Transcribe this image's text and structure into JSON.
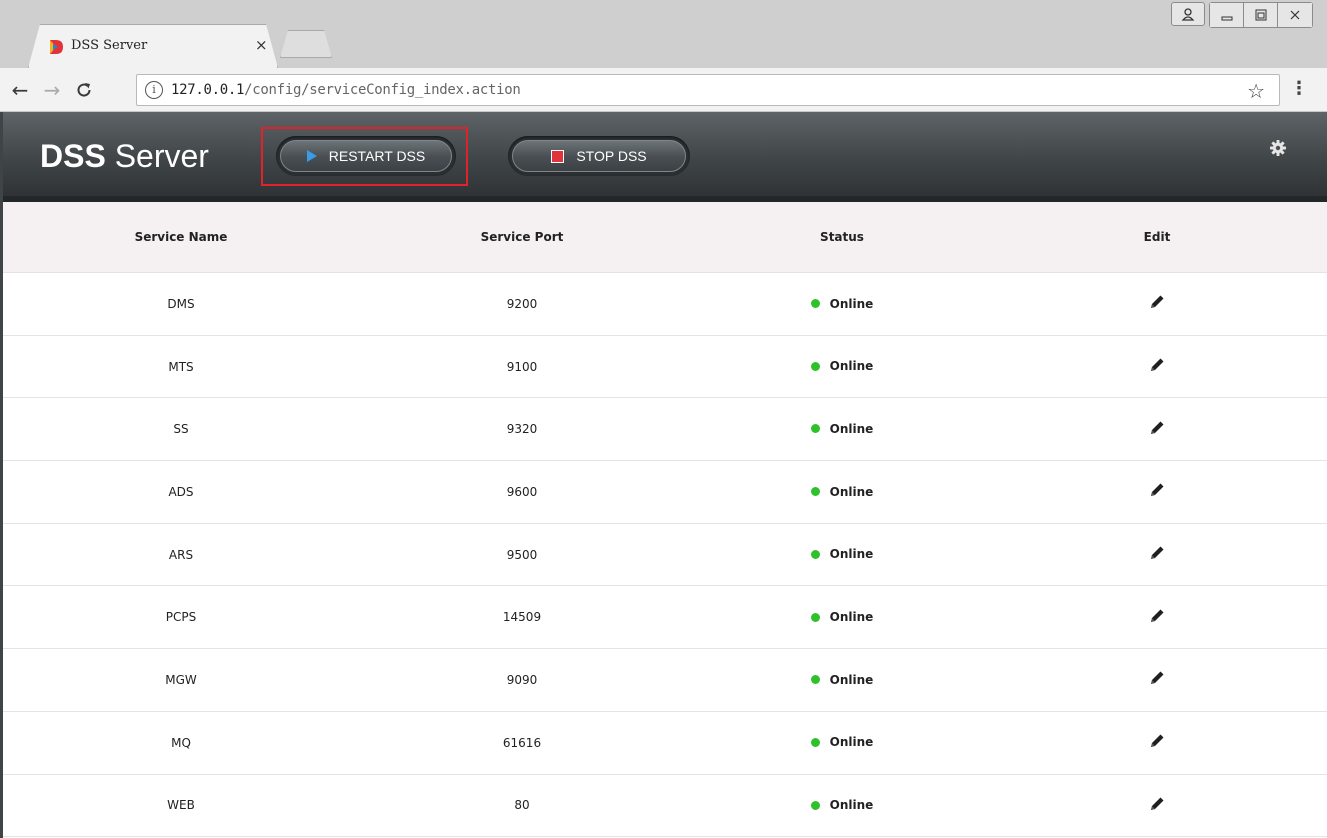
{
  "browser": {
    "tab_title": "DSS Server",
    "tab_close": "×",
    "url_host": "127.0.0.1",
    "url_path": "/config/serviceConfig_index.action",
    "info_symbol": "i"
  },
  "header": {
    "brand_bold": "DSS",
    "brand_light": "Server",
    "restart_label": "RESTART DSS",
    "stop_label": "STOP DSS"
  },
  "table": {
    "columns": [
      "Service Name",
      "Service Port",
      "Status",
      "Edit"
    ],
    "rows": [
      {
        "name": "DMS",
        "port": "9200",
        "status": "Online"
      },
      {
        "name": "MTS",
        "port": "9100",
        "status": "Online"
      },
      {
        "name": "SS",
        "port": "9320",
        "status": "Online"
      },
      {
        "name": "ADS",
        "port": "9600",
        "status": "Online"
      },
      {
        "name": "ARS",
        "port": "9500",
        "status": "Online"
      },
      {
        "name": "PCPS",
        "port": "14509",
        "status": "Online"
      },
      {
        "name": "MGW",
        "port": "9090",
        "status": "Online"
      },
      {
        "name": "MQ",
        "port": "61616",
        "status": "Online"
      },
      {
        "name": "WEB",
        "port": "80",
        "status": "Online"
      }
    ]
  },
  "colors": {
    "online": "#2fc12b",
    "highlight": "#e0232a",
    "header_bg": "#3f4447"
  }
}
